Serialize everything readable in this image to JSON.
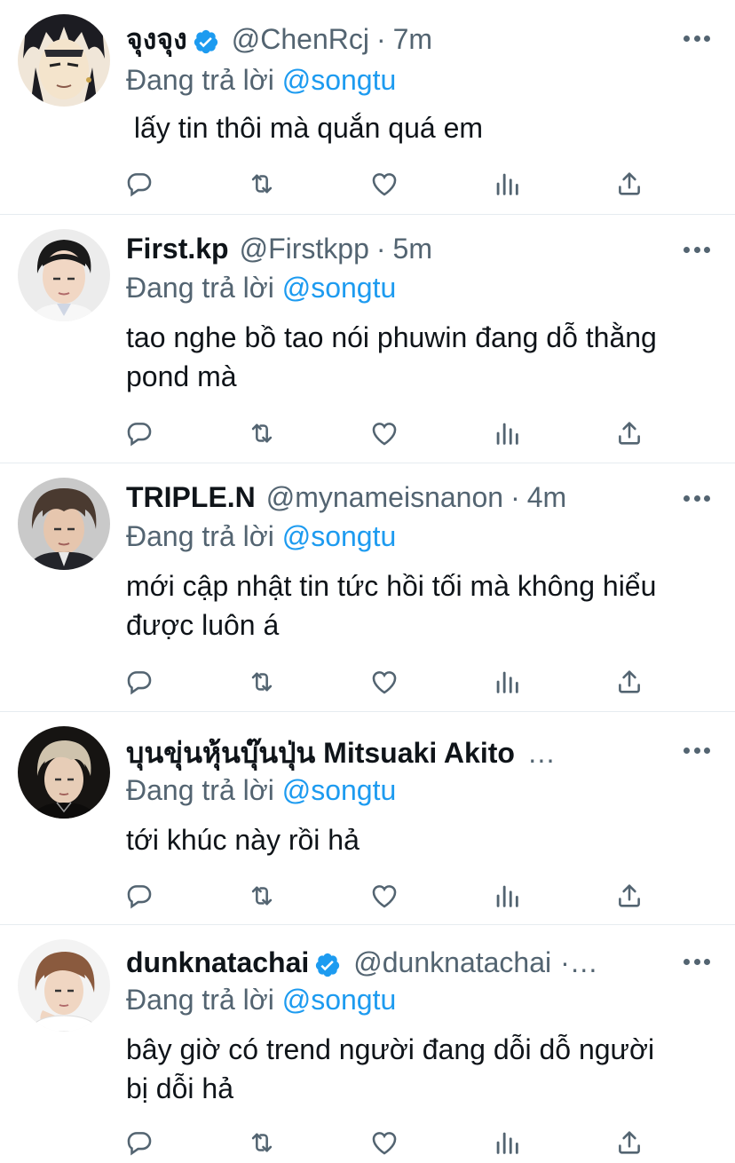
{
  "thread": {
    "reply_prefix": "Đang trả lời",
    "replies": [
      {
        "name": "จุงจุง",
        "verified": true,
        "handle": "@ChenRcj",
        "separator": "·",
        "time": "7m",
        "reply_to": "@songtu",
        "text": " lấy tin thôi mà quắn quá em",
        "avatar": "anime-character-avatar"
      },
      {
        "name": "First.kp",
        "verified": false,
        "handle": "@Firstkpp",
        "separator": "·",
        "time": "5m",
        "reply_to": "@songtu",
        "text": "tao nghe bồ tao nói phuwin đang dỗ thằng pond mà",
        "avatar": "person-portrait-avatar"
      },
      {
        "name": "TRIPLE.N",
        "verified": false,
        "handle": "@mynameisnanon",
        "separator": "·",
        "time": "4m",
        "reply_to": "@songtu",
        "text": "mới cập nhật tin tức hồi tối mà không hiểu được luôn á",
        "avatar": "person-portrait-avatar"
      },
      {
        "name": "บุนขุ่นหุ้นบุ๊นปุ่น Mitsuaki Akito",
        "verified": false,
        "handle": "…",
        "separator": "",
        "time": "",
        "reply_to": "@songtu",
        "text": "tới khúc này rồi hả",
        "avatar": "person-portrait-avatar"
      },
      {
        "name": "dunknatachai",
        "verified": true,
        "handle": "@dunknatachai",
        "separator": "·…",
        "time": "",
        "reply_to": "@songtu",
        "text": "bây giờ có trend người đang dỗi dỗ người bị dỗi hả",
        "avatar": "person-portrait-avatar"
      }
    ]
  },
  "icons": {
    "reply": "reply-icon",
    "retweet": "retweet-icon",
    "like": "like-icon",
    "views": "analytics-icon",
    "share": "share-icon",
    "more": "more-icon",
    "verified": "verified-badge-icon"
  },
  "colors": {
    "text": "#0f1419",
    "secondary": "#536471",
    "accent": "#1d9bf0",
    "divider": "#e6ecf0"
  }
}
